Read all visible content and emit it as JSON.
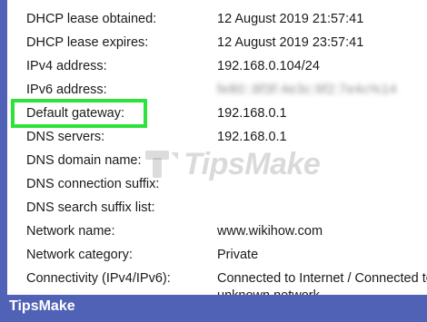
{
  "network_details": {
    "rows": [
      {
        "label": "DHCP lease obtained:",
        "value": "12 August 2019 21:57:41"
      },
      {
        "label": "DHCP lease expires:",
        "value": "12 August 2019 23:57:41"
      },
      {
        "label": "IPv4 address:",
        "value": "192.168.0.104/24"
      },
      {
        "label": "IPv6 address:",
        "value": "fe80::8f3f:4e3c:9f2:7e4c%14"
      },
      {
        "label": "Default gateway:",
        "value": "192.168.0.1"
      },
      {
        "label": "DNS servers:",
        "value": "192.168.0.1"
      },
      {
        "label": "DNS domain name:",
        "value": ""
      },
      {
        "label": "DNS connection suffix:",
        "value": ""
      },
      {
        "label": "DNS search suffix list:",
        "value": ""
      },
      {
        "label": "Network name:",
        "value": "www.wikihow.com"
      },
      {
        "label": "Network category:",
        "value": "Private"
      },
      {
        "label": "Connectivity (IPv4/IPv6):",
        "value": "Connected to Internet / Connected to"
      }
    ],
    "connectivity_continuation": "unknown network"
  },
  "highlight": {
    "color": "#2ee23a"
  },
  "watermark": {
    "text": "TipsMake"
  },
  "footer": {
    "brand": "TipsMake",
    "background": "#4f62b5"
  }
}
